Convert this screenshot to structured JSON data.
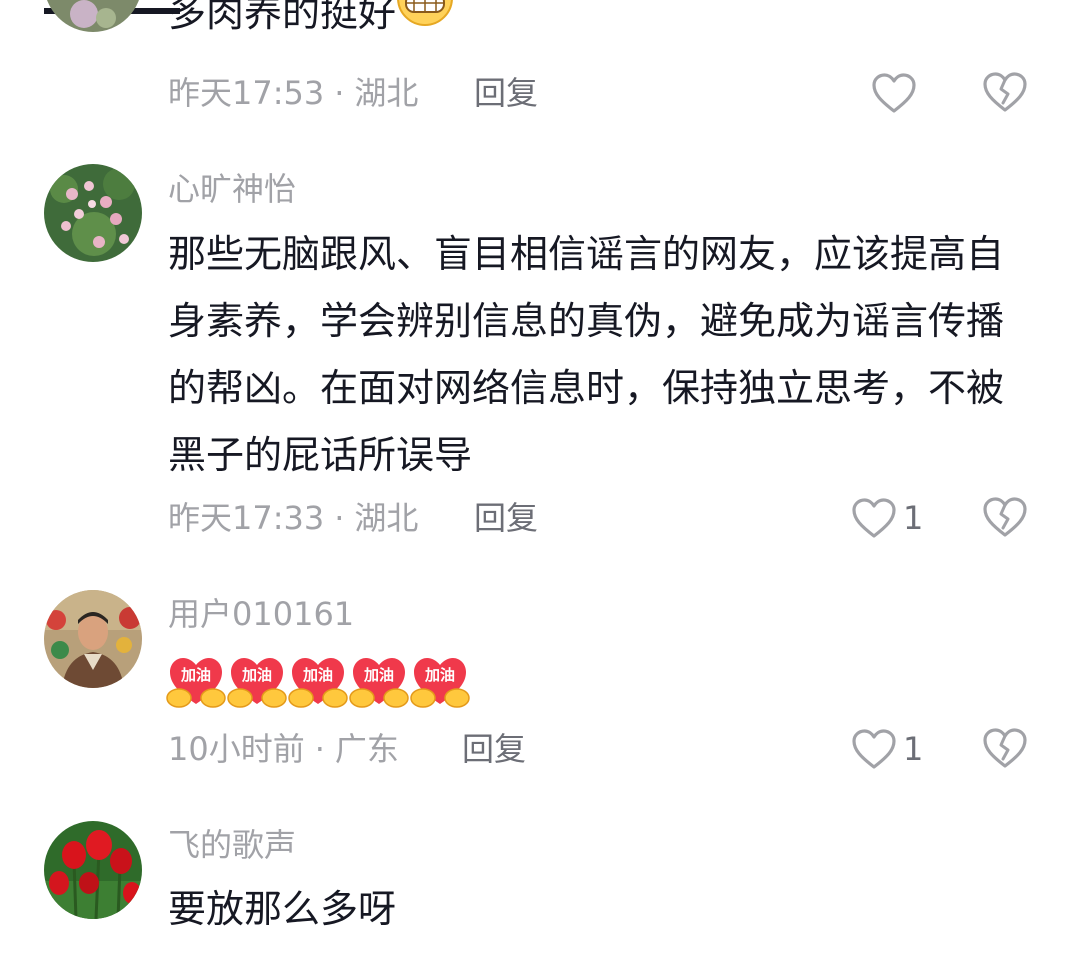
{
  "comments": [
    {
      "username": "",
      "text": "多肉养的挺好",
      "emoji": "grin-emoji",
      "time": "昨天17:53",
      "location": "湖北",
      "reply_label": "回复",
      "likes": ""
    },
    {
      "username": "心旷神怡",
      "text": "那些无脑跟风、盲目相信谣言的网友，应该提高自身素养，学会辨别信息的真伪，避免成为谣言传播的帮凶。在面对网络信息时，保持独立思考，不被黑子的屁话所误导",
      "time": "昨天17:33",
      "location": "湖北",
      "reply_label": "回复",
      "likes": "1"
    },
    {
      "username": "用户010161",
      "stickers": [
        "加油",
        "加油",
        "加油",
        "加油",
        "加油"
      ],
      "time": "10小时前",
      "location": "广东",
      "reply_label": "回复",
      "likes": "1"
    },
    {
      "username": "飞的歌声",
      "text": "要放那么多呀"
    }
  ],
  "separator": "·",
  "icons": {
    "like": "heart-outline-icon",
    "dislike": "broken-heart-icon"
  },
  "colors": {
    "text_primary": "#161823",
    "text_secondary": "#a1a2a7",
    "sticker_red": "#f0394b",
    "sticker_yellow": "#ffc83d"
  }
}
